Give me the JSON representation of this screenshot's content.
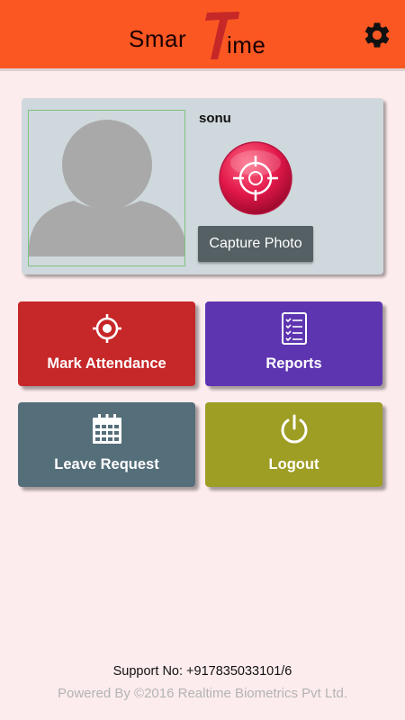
{
  "header": {
    "logo_part1": "Smar",
    "logo_part2": "ime",
    "logo_letter": "T",
    "settings_icon": "gear-icon",
    "bg_color": "#fb5722"
  },
  "profile": {
    "name": "sonu",
    "avatar_icon": "default-user-avatar",
    "capture_icon": "crosshair-target-icon",
    "capture_label": "Capture Photo"
  },
  "tiles": [
    {
      "label": "Mark Attendance",
      "icon": "crosshair-icon",
      "color": "#c62728"
    },
    {
      "label": "Reports",
      "icon": "checklist-icon",
      "color": "#5e35b1"
    },
    {
      "label": "Leave Request",
      "icon": "calendar-icon",
      "color": "#546e7a"
    },
    {
      "label": "Logout",
      "icon": "power-icon",
      "color": "#9e9d24"
    }
  ],
  "footer": {
    "support": "Support No: +917835033101/6",
    "powered": "Powered By ©2016 Realtime Biometrics Pvt Ltd."
  }
}
